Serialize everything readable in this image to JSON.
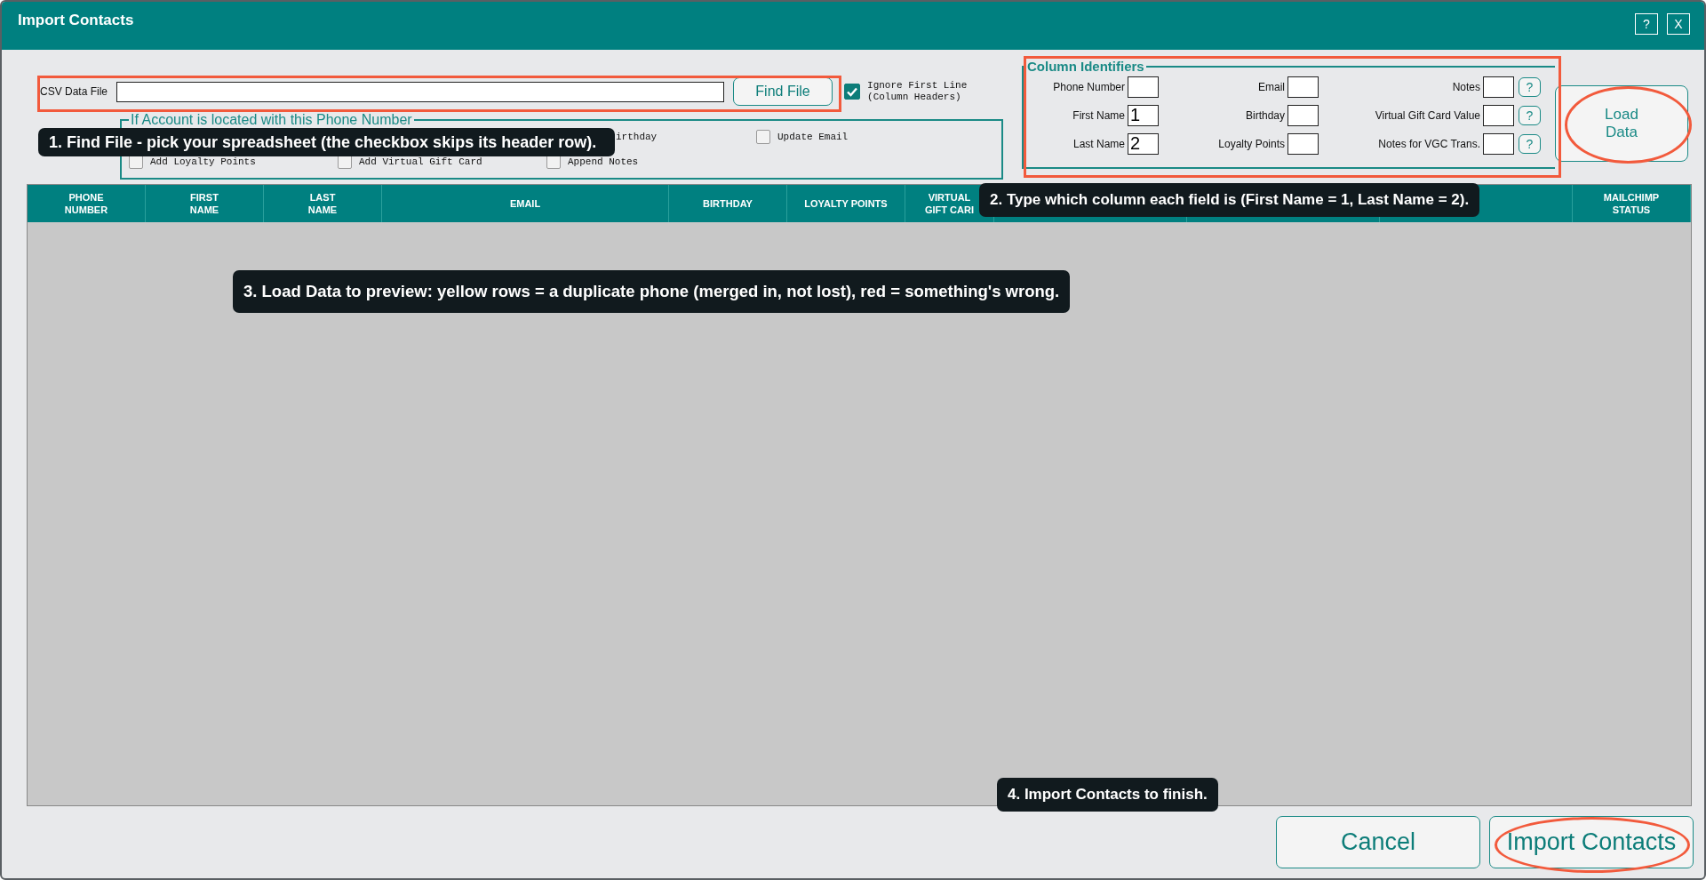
{
  "window": {
    "title": "Import Contacts",
    "buttons": [
      {
        "label": "?"
      },
      {
        "label": "X"
      }
    ]
  },
  "csv": {
    "label": "CSV Data File",
    "button": "Find File",
    "ignore_first_line": {
      "label": "Ignore First Line\n(Column Headers)",
      "checked": true
    }
  },
  "options": {
    "legend": "If Account is located with this Phone Number",
    "top_line": [
      {
        "label": "irthday",
        "kind": "covered"
      },
      {
        "label": "Update Email",
        "checked": false,
        "kind": "checkbox"
      }
    ],
    "bottom_line": [
      {
        "label": "Add Loyalty Points",
        "checked": false,
        "kind": "checkbox"
      },
      {
        "label": "Add Virtual Gift Card",
        "checked": false,
        "kind": "checkbox"
      },
      {
        "label": "Append Notes",
        "checked": false,
        "kind": "checkbox"
      }
    ]
  },
  "column_identifiers": {
    "legend": "Column Identifiers",
    "fields": [
      {
        "label": "Phone Number",
        "help": false
      },
      {
        "label": "Email",
        "help": false
      },
      {
        "label": "Notes",
        "help": true
      },
      {
        "label": "First Name",
        "value": "1",
        "help": false
      },
      {
        "label": "Birthday",
        "help": false
      },
      {
        "label": "Virtual Gift Card Value",
        "help": true
      },
      {
        "label": "Last Name",
        "value": "2",
        "help": false
      },
      {
        "label": "Loyalty Points",
        "help": false
      },
      {
        "label": "Notes for VGC Trans.",
        "help": true
      }
    ],
    "help_label": "?",
    "load_button": "Load\nData"
  },
  "table": {
    "columns": [
      {
        "label": "PHONE\nNUMBER"
      },
      {
        "label": "FIRST\nNAME"
      },
      {
        "label": "LAST\nNAME"
      },
      {
        "label": "EMAIL",
        "kind": "wide"
      },
      {
        "label": "BIRTHDAY"
      },
      {
        "label": "LOYALTY POINTS"
      },
      {
        "label": "VIRTUAL\nGIFT CARI",
        "kind": "narrow"
      },
      {
        "kind": "covered"
      },
      {
        "kind": "covered"
      },
      {
        "kind": "covered"
      },
      {
        "label": "MAILCHIMP\nSTATUS"
      }
    ]
  },
  "buttons": [
    {
      "label": "Cancel"
    },
    {
      "label": "Import Contacts"
    }
  ],
  "callouts": [
    {
      "text": "1. Find File - pick your spreadsheet (the checkbox skips its header row).",
      "kind": "step1"
    },
    {
      "text": "2. Type which column each field is (First Name = 1, Last Name = 2).",
      "kind": "step2"
    },
    {
      "text": "3. Load Data to preview: yellow rows = a duplicate phone (merged in, not lost), red = something's wrong.",
      "kind": "step3"
    },
    {
      "text": "4. Import Contacts to finish.",
      "kind": "step4"
    }
  ]
}
